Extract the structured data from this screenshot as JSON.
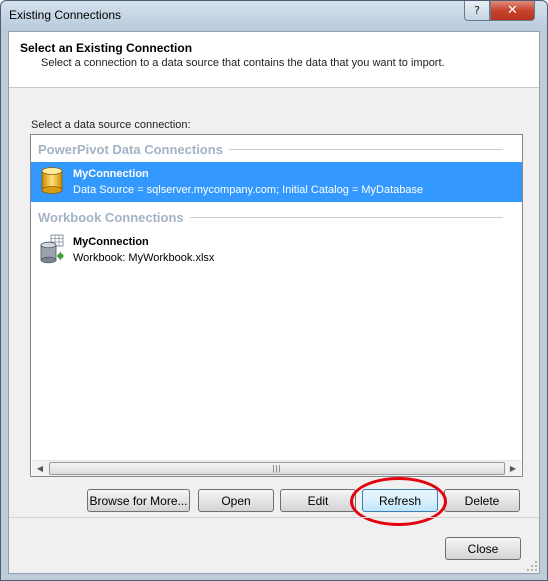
{
  "window": {
    "title": "Existing Connections",
    "help_glyph": "?",
    "close_glyph": "✕"
  },
  "header": {
    "title": "Select an Existing Connection",
    "description": "Select a connection to a data source that contains the data that you want to import."
  },
  "list": {
    "label": "Select a data source connection:",
    "groups": [
      {
        "title": "PowerPivot Data Connections",
        "items": [
          {
            "name": "MyConnection",
            "detail": "Data Source = sqlserver.mycompany.com; Initial Catalog = MyDatabase",
            "icon": "database-icon",
            "selected": true
          }
        ]
      },
      {
        "title": "Workbook Connections",
        "items": [
          {
            "name": "MyConnection",
            "detail": "Workbook: MyWorkbook.xlsx",
            "icon": "workbook-connection-icon",
            "selected": false
          }
        ]
      }
    ],
    "scroll_left_glyph": "◀",
    "scroll_right_glyph": "▶",
    "thumb_grip": "|||"
  },
  "buttons": {
    "browse": "Browse for More...",
    "open": "Open",
    "edit": "Edit",
    "refresh": "Refresh",
    "delete": "Delete",
    "close": "Close"
  },
  "colors": {
    "selection": "#3399ff",
    "group_header": "#a3b3c5",
    "highlight_circle": "#e3000f"
  }
}
